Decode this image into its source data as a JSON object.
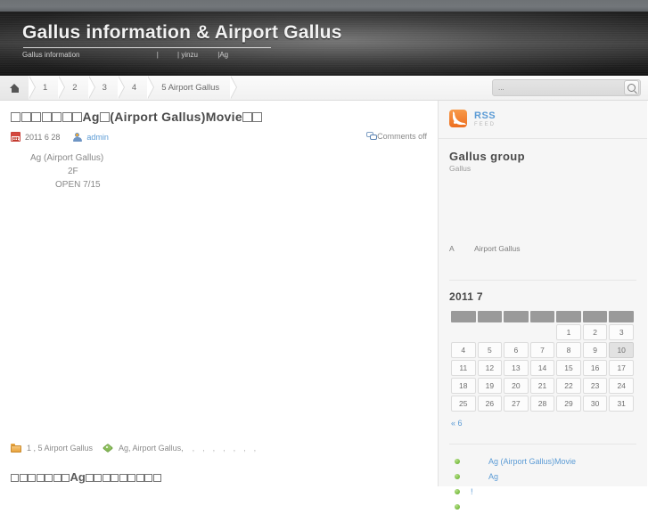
{
  "header": {
    "title": "Gallus  information & Airport Gallus",
    "subnav": {
      "home": "Gallus information",
      "sep1": "|",
      "item2": "| yinzu",
      "item3": "|Ag"
    }
  },
  "breadcrumb": {
    "home_icon": "home-icon",
    "items": [
      "1",
      "2",
      "3",
      "4",
      "5 Airport Gallus"
    ]
  },
  "search": {
    "placeholder": "...",
    "value": "",
    "button_icon": "search-icon"
  },
  "post": {
    "title_prefix_tofu": 7,
    "title_mid": "Ag",
    "title_tofu_mid": 1,
    "title_tail": "(Airport Gallus)Movie",
    "title_tofu_end": 2,
    "date": "2011  6  28",
    "author": "admin",
    "comments": "Comments off",
    "body": {
      "line1": "Ag (Airport Gallus)",
      "line2": "2F",
      "line3": "OPEN 7/15"
    },
    "footer": {
      "category_icon": "folder-icon",
      "category": "1    , 5 Airport Gallus",
      "tag_icon": "tag-icon",
      "tags": "Ag, Airport Gallus,"
    }
  },
  "post2": {
    "title_prefix_tofu": 7,
    "title_mid": "Ag",
    "title_tofu_end": 9
  },
  "sidebar": {
    "rss": {
      "label": "RSS",
      "sublabel": "FEED",
      "icon": "rss-icon"
    },
    "group": {
      "title": "Gallus group",
      "subtitle": "Gallus",
      "row_key": "A",
      "row_value": "Airport Gallus"
    },
    "calendar": {
      "title": "2011  7",
      "weekday_headers": [
        "",
        "",
        "",
        "",
        "",
        "",
        ""
      ],
      "weeks": [
        [
          "",
          "",
          "",
          "",
          "1",
          "2",
          "3"
        ],
        [
          "4",
          "5",
          "6",
          "7",
          "8",
          "9",
          "10"
        ],
        [
          "11",
          "12",
          "13",
          "14",
          "15",
          "16",
          "17"
        ],
        [
          "18",
          "19",
          "20",
          "21",
          "22",
          "23",
          "24"
        ],
        [
          "25",
          "26",
          "27",
          "28",
          "29",
          "30",
          "31"
        ]
      ],
      "today": "10",
      "prev_link": "« 6"
    },
    "links": [
      {
        "text": "Ag (Airport Gallus)Movie",
        "indent": "wide"
      },
      {
        "text": "Ag",
        "indent": "wide"
      },
      {
        "text": "!",
        "indent": "tight"
      },
      {
        "text": "",
        "indent": "tight"
      }
    ]
  },
  "colors": {
    "accent_link": "#5b9bd5",
    "rss_orange": "#ed6f20",
    "bullet_green": "#77bb3f",
    "header_dark": "#2c2c2c",
    "sidebar_bg": "#f6f6f6"
  }
}
